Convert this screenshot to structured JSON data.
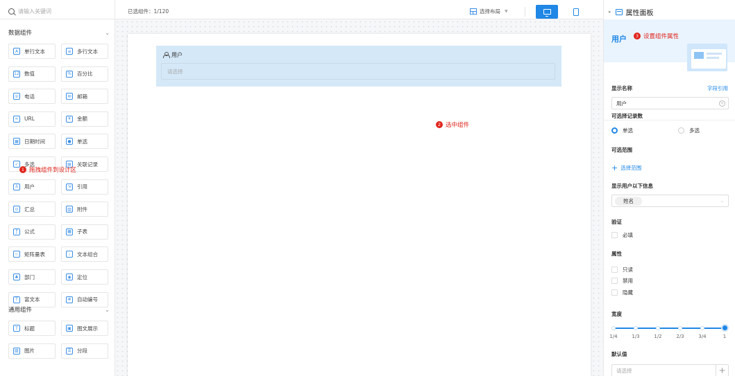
{
  "left_panel": {
    "search_placeholder": "请输入关键词",
    "group_data": {
      "title": "数据组件",
      "items": [
        {
          "label": "单行文本",
          "icon": "text-single-icon",
          "glyph": "A"
        },
        {
          "label": "多行文本",
          "icon": "text-multi-icon",
          "glyph": "≡"
        },
        {
          "label": "数值",
          "icon": "number-icon",
          "glyph": "12"
        },
        {
          "label": "百分比",
          "icon": "percent-icon",
          "glyph": "%"
        },
        {
          "label": "电话",
          "icon": "phone-icon",
          "glyph": "☏"
        },
        {
          "label": "邮箱",
          "icon": "mail-icon",
          "glyph": "✉"
        },
        {
          "label": "URL",
          "icon": "link-icon",
          "glyph": "∞"
        },
        {
          "label": "金额",
          "icon": "money-icon",
          "glyph": "¥"
        },
        {
          "label": "日期时间",
          "icon": "calendar-icon",
          "glyph": "▦"
        },
        {
          "label": "单选",
          "icon": "radio-icon",
          "glyph": "●"
        },
        {
          "label": "多选",
          "icon": "checkbox-icon",
          "glyph": "✓"
        },
        {
          "label": "关联记录",
          "icon": "relation-icon",
          "glyph": "▤"
        },
        {
          "label": "用户",
          "icon": "user-icon",
          "glyph": "♙"
        },
        {
          "label": "引用",
          "icon": "quote-icon",
          "glyph": "⇲"
        },
        {
          "label": "汇总",
          "icon": "summary-icon",
          "glyph": "⊙"
        },
        {
          "label": "附件",
          "icon": "attachment-icon",
          "glyph": "▥"
        },
        {
          "label": "公式",
          "icon": "formula-icon",
          "glyph": "ƒ"
        },
        {
          "label": "子表",
          "icon": "subtable-icon",
          "glyph": "▦"
        },
        {
          "label": "矩阵量表",
          "icon": "matrix-icon",
          "glyph": "☆"
        },
        {
          "label": "文本组合",
          "icon": "text-combo-icon",
          "glyph": "⁝"
        },
        {
          "label": "部门",
          "icon": "department-icon",
          "glyph": "♣"
        },
        {
          "label": "定位",
          "icon": "location-icon",
          "glyph": "◉"
        },
        {
          "label": "富文本",
          "icon": "richtext-icon",
          "glyph": "T"
        },
        {
          "label": "自动编号",
          "icon": "auto-number-icon",
          "glyph": "#"
        }
      ]
    },
    "group_common": {
      "title": "通用组件",
      "items": [
        {
          "label": "标题",
          "icon": "heading-icon",
          "glyph": "T"
        },
        {
          "label": "图文展示",
          "icon": "image-text-icon",
          "glyph": "▣"
        },
        {
          "label": "图片",
          "icon": "image-icon",
          "glyph": "▨"
        },
        {
          "label": "分段",
          "icon": "section-icon",
          "glyph": "☰"
        }
      ]
    },
    "hint_num": "1",
    "hint_text": "拖拽组件到设计区"
  },
  "toolbar": {
    "selected_label": "已选组件：1/120",
    "layout_label": "选择布局",
    "layout_dropdown": "▼"
  },
  "canvas": {
    "field_label": "用户",
    "field_placeholder": "请选择",
    "hint_num": "2",
    "hint_text": "选中组件"
  },
  "right_panel": {
    "header": "属性面板",
    "title": "用户",
    "hint_num": "3",
    "hint_text": "设置组件属性",
    "display_name_label": "显示名称",
    "field_ref_link": "字段引用",
    "display_name_value": "用户",
    "selectable_count_label": "可选择记录数",
    "single_label": "单选",
    "multi_label": "多选",
    "range_label": "可选范围",
    "range_link": "选择范围",
    "show_info_label": "显示用户以下信息",
    "info_tag": "姓名",
    "validation_label": "验证",
    "required_label": "必填",
    "attribute_label": "属性",
    "readonly_label": "只读",
    "disabled_label": "禁用",
    "hidden_label": "隐藏",
    "width_label": "宽度",
    "width_ticks": [
      "1/4",
      "1/3",
      "1/2",
      "2/3",
      "3/4",
      "1"
    ],
    "width_value": "1",
    "default_label": "默认值",
    "default_placeholder": "请选择"
  },
  "colors": {
    "accent": "#1f87e5",
    "hint_red": "#e0241b",
    "selection_bg": "#d4e8f8"
  }
}
